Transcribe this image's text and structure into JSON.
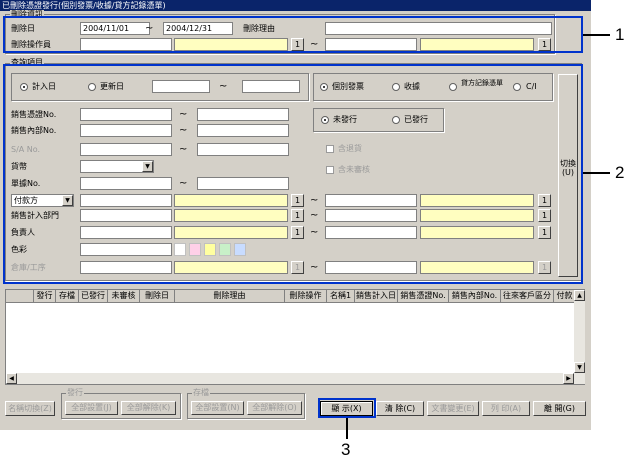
{
  "window": {
    "title": "已刪除憑證發行(個別發票/收據/貸方記錄憑單)"
  },
  "delete_info": {
    "group_label": "刪除資訊",
    "delete_date_label": "刪除日",
    "date_from": "2004/11/01",
    "date_to": "2004/12/31",
    "tilde": "~",
    "reason_label": "刪除理由",
    "reason_value": "",
    "operator_label": "刪除操作員",
    "lookup_label": "1"
  },
  "search": {
    "group_label": "查詢項目",
    "date_radios": [
      {
        "label": "計入日",
        "checked": true
      },
      {
        "label": "更新日",
        "checked": false
      }
    ],
    "doc_radios": [
      {
        "label": "個別發票",
        "checked": true
      },
      {
        "label": "收據",
        "checked": false
      },
      {
        "label": "貸方記錄憑單",
        "checked": false
      },
      {
        "label": "C/I",
        "checked": false
      }
    ],
    "issue_radios": [
      {
        "label": "未發行",
        "checked": true
      },
      {
        "label": "已發行",
        "checked": false
      }
    ],
    "fields": {
      "sales_doc_no": "銷售憑證No.",
      "sales_internal_no": "銷售內部No.",
      "sa_no": "S/A No.",
      "currency": "貨幣",
      "order_no": "單據No.",
      "payer_select": "付款方",
      "sales_dept": "銷售計入部門",
      "person_in_charge": "負責人",
      "color": "色彩",
      "warehouse": "倉庫/工序"
    },
    "checkboxes": [
      {
        "label": "含退貨",
        "checked": false
      },
      {
        "label": "含未審核",
        "checked": false
      }
    ],
    "switch_button": "切換(U)"
  },
  "table": {
    "columns": [
      "發行",
      "存檔",
      "已發行",
      "未審核",
      "刪除日",
      "刪除理由",
      "刪除操作",
      "名稱1",
      "銷售計入日",
      "銷售憑證No.",
      "銷售內部No.",
      "往來客戶區分",
      "付款"
    ],
    "rows": []
  },
  "bottom": {
    "name_switch": "名稱切換(Z)",
    "issue_group": "發行",
    "issue_all_set": "全部設置(J)",
    "issue_all_clear": "全部解除(K)",
    "archive_group": "存檔",
    "archive_all_set": "全部設置(N)",
    "archive_all_clear": "全部解除(O)",
    "display": "顯 示(X)",
    "clear": "清 除(C)",
    "doc_change": "文書變更(E)",
    "print": "列 印(A)",
    "close": "離 開(G)"
  },
  "callouts": [
    "1",
    "2",
    "3"
  ],
  "colors": {
    "title_bg": "#0a246a",
    "highlight": "#0033cc",
    "face": "#d4d0c8",
    "yellow_field": "#fffec0"
  }
}
